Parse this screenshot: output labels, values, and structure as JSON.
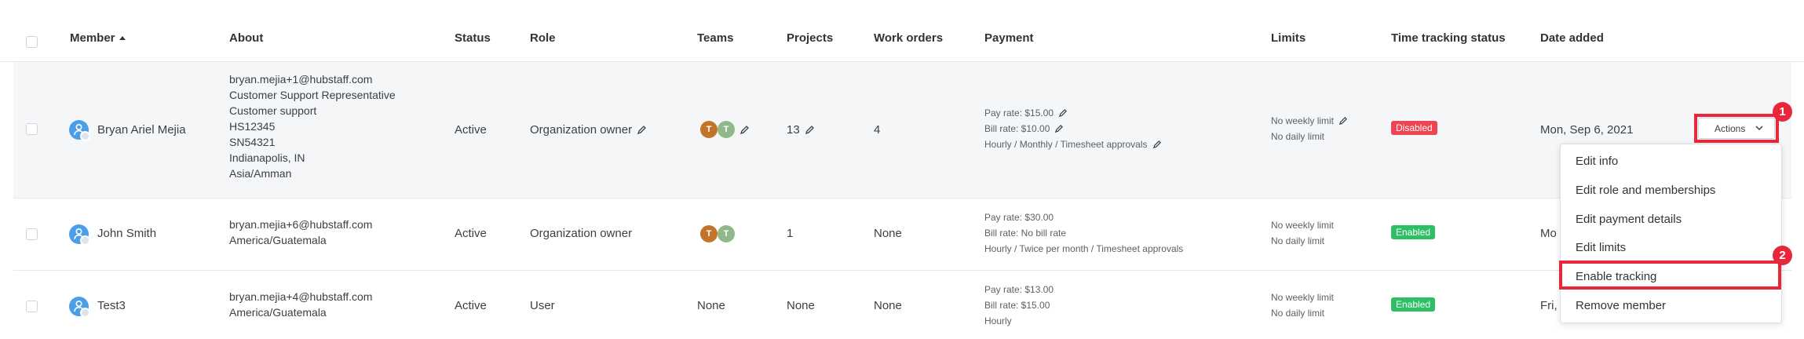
{
  "header": {
    "member": "Member",
    "about": "About",
    "status": "Status",
    "role": "Role",
    "teams": "Teams",
    "projects": "Projects",
    "work_orders": "Work orders",
    "payment": "Payment",
    "limits": "Limits",
    "time_tracking_status": "Time tracking status",
    "date_added": "Date added"
  },
  "rows": [
    {
      "name": "Bryan Ariel Mejia",
      "about": [
        "bryan.mejia+1@hubstaff.com",
        "Customer Support Representative",
        "Customer support",
        "HS12345",
        "SN54321",
        "Indianapolis, IN",
        "Asia/Amman"
      ],
      "status": "Active",
      "role": "Organization owner",
      "teams": [
        "T",
        "T"
      ],
      "projects": "13",
      "work_orders": "4",
      "pay_rate": "Pay rate: $15.00",
      "bill_rate": "Bill rate: $10.00",
      "pay_type": "Hourly",
      "pay_period": "Monthly",
      "pay_approvals": "Timesheet approvals",
      "weekly_limit": "No weekly limit",
      "daily_limit": "No daily limit",
      "tracking": "Disabled",
      "date_added": "Mon, Sep 6, 2021"
    },
    {
      "name": "John Smith",
      "about": [
        "bryan.mejia+6@hubstaff.com",
        "America/Guatemala"
      ],
      "status": "Active",
      "role": "Organization owner",
      "teams": [
        "T",
        "T"
      ],
      "projects": "1",
      "work_orders": "None",
      "pay_rate": "Pay rate: $30.00",
      "bill_rate": "Bill rate: No bill rate",
      "pay_type": "Hourly",
      "pay_period": "Twice per month",
      "pay_approvals": "Timesheet approvals",
      "weekly_limit": "No weekly limit",
      "daily_limit": "No daily limit",
      "tracking": "Enabled",
      "date_added": "Mo"
    },
    {
      "name": "Test3",
      "about": [
        "bryan.mejia+4@hubstaff.com",
        "America/Guatemala"
      ],
      "status": "Active",
      "role": "User",
      "teams": "None",
      "projects": "None",
      "work_orders": "None",
      "pay_rate": "Pay rate: $13.00",
      "bill_rate": "Bill rate: $15.00",
      "pay_type": "Hourly",
      "weekly_limit": "No weekly limit",
      "daily_limit": "No daily limit",
      "tracking": "Enabled",
      "date_added": "Fri,"
    }
  ],
  "separator": "/",
  "actions_label": "Actions",
  "menu": {
    "items": [
      "Edit info",
      "Edit role and memberships",
      "Edit payment details",
      "Edit limits",
      "Enable tracking",
      "Remove member"
    ]
  },
  "callouts": [
    "1",
    "2"
  ],
  "colors": {
    "highlight": "#e8283a",
    "disabled_badge": "#ef4454",
    "enabled_badge": "#2dbf64",
    "avatar": "#4a9fe8"
  }
}
